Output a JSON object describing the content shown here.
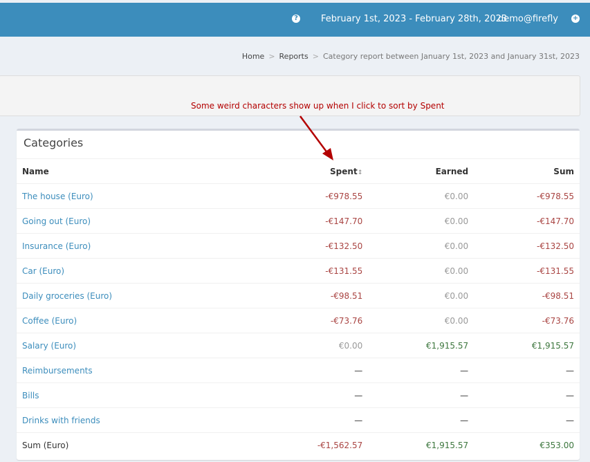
{
  "topbar": {
    "help_icon": "question-circle-icon",
    "date_range": "February 1st, 2023 - February 28th, 2023",
    "user": "demo@firefly",
    "add_icon": "plus-circle-icon"
  },
  "breadcrumb": {
    "home": "Home",
    "reports": "Reports",
    "current": "Category report between January 1st, 2023 and January 31st, 2023"
  },
  "annotation": "Some weird characters show up when I click to sort by Spent",
  "categories": {
    "title": "Categories",
    "columns": {
      "name": "Name",
      "spent": "Spent",
      "earned": "Earned",
      "sum": "Sum"
    },
    "rows": [
      {
        "name": "The house (Euro)",
        "spent": "-€978.55",
        "earned": "€0.00",
        "sum": "-€978.55"
      },
      {
        "name": "Going out (Euro)",
        "spent": "-€147.70",
        "earned": "€0.00",
        "sum": "-€147.70"
      },
      {
        "name": "Insurance (Euro)",
        "spent": "-€132.50",
        "earned": "€0.00",
        "sum": "-€132.50"
      },
      {
        "name": "Car (Euro)",
        "spent": "-€131.55",
        "earned": "€0.00",
        "sum": "-€131.55"
      },
      {
        "name": "Daily groceries (Euro)",
        "spent": "-€98.51",
        "earned": "€0.00",
        "sum": "-€98.51"
      },
      {
        "name": "Coffee (Euro)",
        "spent": "-€73.76",
        "earned": "€0.00",
        "sum": "-€73.76"
      },
      {
        "name": "Salary (Euro)",
        "spent": "€0.00",
        "earned": "€1,915.57",
        "sum": "€1,915.57"
      },
      {
        "name": "Reimbursements",
        "spent": "—",
        "earned": "—",
        "sum": "—"
      },
      {
        "name": "Bills",
        "spent": "—",
        "earned": "—",
        "sum": "—"
      },
      {
        "name": "Drinks with friends",
        "spent": "—",
        "earned": "—",
        "sum": "—"
      }
    ],
    "total": {
      "name": "Sum (Euro)",
      "spent": "-€1,562.57",
      "earned": "€1,915.57",
      "sum": "€353.00"
    }
  },
  "colors": {
    "header": "#3c8dbc",
    "negative": "#a94442",
    "positive": "#3c763d",
    "annotation": "#b30000"
  }
}
